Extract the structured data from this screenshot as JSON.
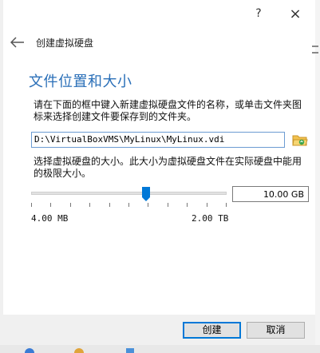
{
  "titlebar": {
    "help_glyph": "?",
    "close_glyph": "×"
  },
  "header": {
    "breadcrumb": "创建虚拟硬盘"
  },
  "section_title": "文件位置和大小",
  "location": {
    "instructions": "请在下面的框中键入新建虚拟硬盘文件的名称，或单击文件夹图标来选择创建文件要保存到的文件夹。",
    "path_value": "D:\\VirtualBoxVMS\\MyLinux\\MyLinux.vdi"
  },
  "size": {
    "instructions": "选择虚拟硬盘的大小。此大小为虚拟硬盘文件在实际硬盘中能用的极限大小。",
    "value_text": "10.00 GB",
    "min_label": "4.00 MB",
    "max_label": "2.00 TB",
    "slider_fraction": 0.6
  },
  "buttons": {
    "create": "创建",
    "cancel": "取消"
  },
  "colors": {
    "accent": "#2a6fb8",
    "focus": "#0078d7"
  }
}
